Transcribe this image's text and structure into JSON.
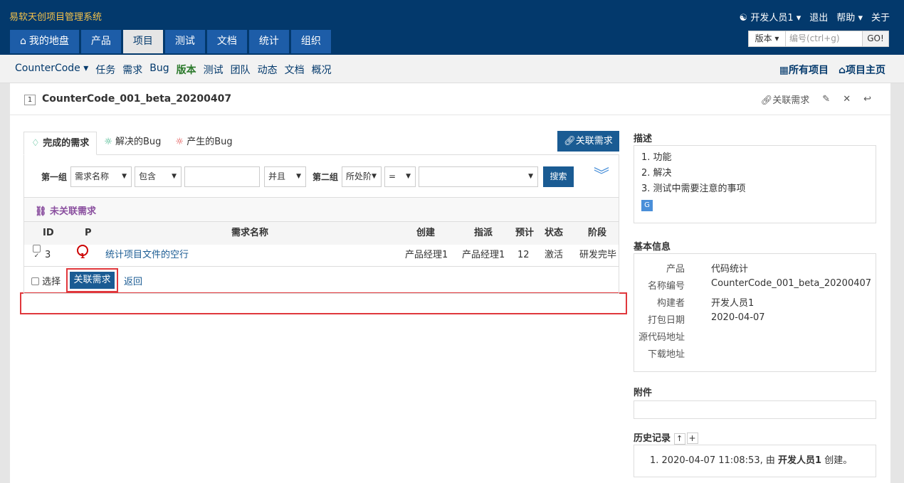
{
  "app": {
    "title": "易软天创项目管理系统"
  },
  "user_nav": {
    "user": "开发人员1",
    "logout": "退出",
    "help": "帮助",
    "about": "关于"
  },
  "main_nav": [
    {
      "label": "我的地盘",
      "icon": "home-icon"
    },
    {
      "label": "产品"
    },
    {
      "label": "项目"
    },
    {
      "label": "测试"
    },
    {
      "label": "文档"
    },
    {
      "label": "统计"
    },
    {
      "label": "组织"
    }
  ],
  "quick_search": {
    "type": "版本",
    "placeholder": "编号(ctrl+g)",
    "go": "GO!"
  },
  "subnav": {
    "project": "CounterCode",
    "items": [
      "任务",
      "需求",
      "Bug",
      "版本",
      "测试",
      "团队",
      "动态",
      "文档",
      "概况"
    ],
    "all_projects": "所有项目",
    "project_home": "项目主页"
  },
  "build": {
    "id": "1",
    "title": "CounterCode_001_beta_20200407",
    "link_story": "关联需求"
  },
  "tabs": {
    "done_stories": "完成的需求",
    "resolved_bugs": "解决的Bug",
    "created_bugs": "产生的Bug",
    "link_button": "关联需求"
  },
  "search": {
    "group1": "第一组",
    "field1": "需求名称",
    "op1": "包含",
    "value1": "",
    "logic": "并且",
    "group2": "第二组",
    "field2": "所处阶",
    "op2": "=",
    "value2": "",
    "search_button": "搜索"
  },
  "unlinked": {
    "label": "未关联需求"
  },
  "table": {
    "headers": {
      "id": "ID",
      "p": "P",
      "name": "需求名称",
      "creator": "创建",
      "assigned": "指派",
      "estimate": "预计",
      "status": "状态",
      "stage": "阶段"
    },
    "rows": [
      {
        "id": "3",
        "pri": "1",
        "name": "统计项目文件的空行",
        "creator": "产品经理1",
        "assigned": "产品经理1",
        "estimate": "12",
        "status": "激活",
        "stage": "研发完毕"
      }
    ]
  },
  "footer": {
    "select_all": "选择",
    "link": "关联需求",
    "back": "返回"
  },
  "description": {
    "title": "描述",
    "lines": [
      "1. 功能",
      "2. 解决",
      "3. 测试中需要注意的事项"
    ]
  },
  "basic_info": {
    "title": "基本信息",
    "rows": [
      {
        "k": "产品",
        "v": "代码统计"
      },
      {
        "k": "名称编号",
        "v": "CounterCode_001_beta_20200407"
      },
      {
        "k": "构建者",
        "v": "开发人员1"
      },
      {
        "k": "打包日期",
        "v": "2020-04-07"
      },
      {
        "k": "源代码地址",
        "v": ""
      },
      {
        "k": "下载地址",
        "v": ""
      }
    ]
  },
  "attachments": {
    "title": "附件"
  },
  "history": {
    "title": "历史记录",
    "entry_prefix": "1. 2020-04-07 11:08:53, 由 ",
    "entry_user": "开发人员1",
    "entry_suffix": " 创建。"
  }
}
